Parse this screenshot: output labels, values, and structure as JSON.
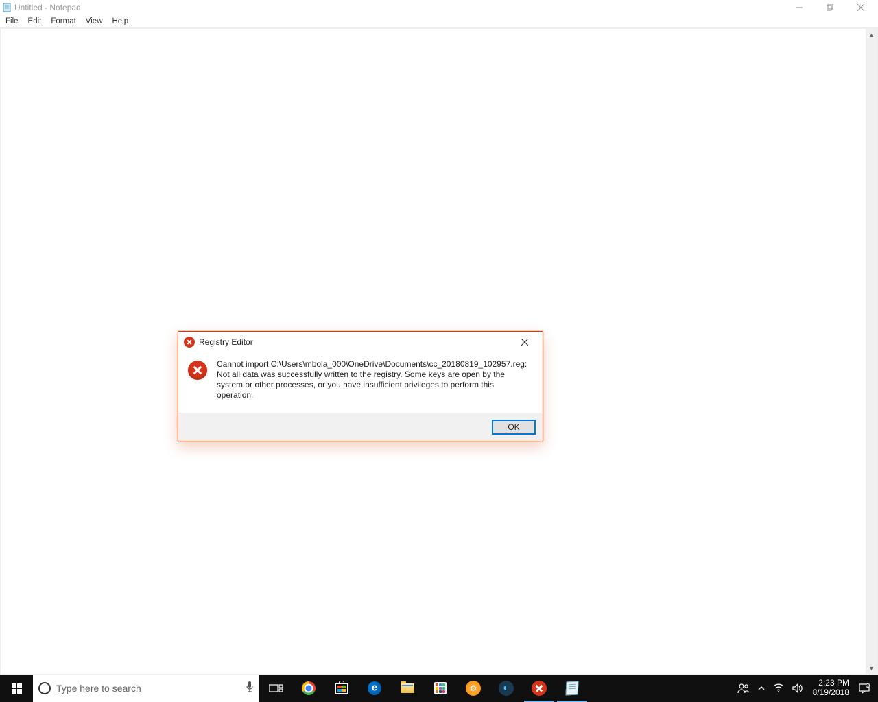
{
  "notepad": {
    "title": "Untitled - Notepad",
    "menu": [
      "File",
      "Edit",
      "Format",
      "View",
      "Help"
    ],
    "content": ""
  },
  "dialog": {
    "title": "Registry Editor",
    "message": "Cannot import C:\\Users\\mbola_000\\OneDrive\\Documents\\cc_20180819_102957.reg: Not all data was successfully written to the registry.  Some keys are open by the system or other processes, or you have insufficient privileges to perform this operation.",
    "ok_label": "OK"
  },
  "taskbar": {
    "search_placeholder": "Type here to search",
    "clock": {
      "time": "2:23 PM",
      "date": "8/19/2018"
    }
  }
}
